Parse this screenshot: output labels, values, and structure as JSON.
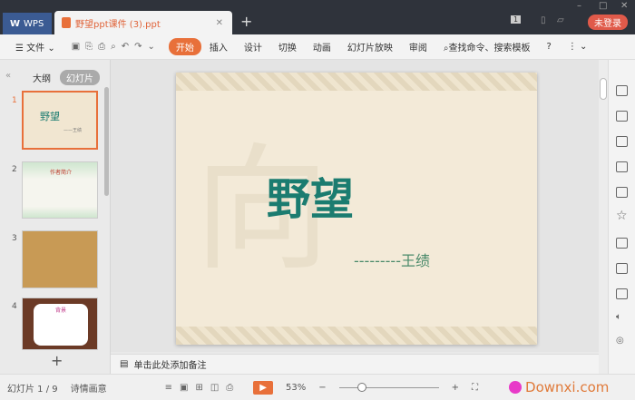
{
  "titlebar": {
    "wps_label": "WPS",
    "doc_tab": "野望ppt课件 (3).ppt",
    "new_tab": "+",
    "login": "未登录",
    "badge": "1"
  },
  "toolbar": {
    "file": "文件",
    "tabs": [
      "开始",
      "插入",
      "设计",
      "切换",
      "动画",
      "幻灯片放映",
      "审阅"
    ],
    "search": "查找命令、搜索模板",
    "help": "?"
  },
  "left_panel": {
    "tab_outline": "大纲",
    "tab_slides": "幻灯片",
    "add": "+",
    "slides": [
      {
        "num": "1",
        "title": "野望",
        "sub": "——王绩"
      },
      {
        "num": "2",
        "title": "作者简介"
      },
      {
        "num": "3"
      },
      {
        "num": "4",
        "title": "背景"
      }
    ]
  },
  "slide": {
    "title": "野望",
    "subtitle": "---------王绩"
  },
  "notes": {
    "placeholder": "单击此处添加备注"
  },
  "status": {
    "slide_counter": "幻灯片 1 / 9",
    "theme": "诗情画意",
    "zoom": "53%",
    "minus": "−",
    "plus": "+",
    "watermark": "Downxi.com"
  },
  "colors": {
    "accent": "#e8703a",
    "title": "#1b7c70"
  }
}
